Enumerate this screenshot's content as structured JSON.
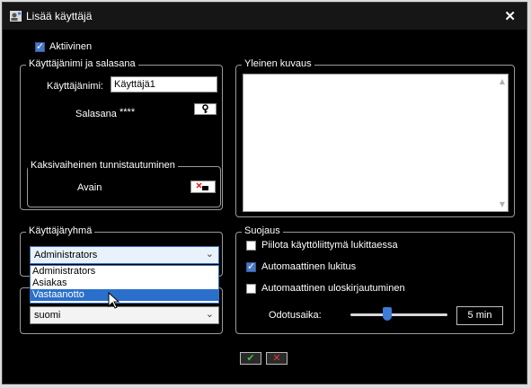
{
  "window": {
    "title": "Lisää käyttäjä"
  },
  "active": {
    "label": "Aktiivinen",
    "checked": true
  },
  "credentials": {
    "legend": "Käyttäjänimi ja salasana",
    "username_label": "Käyttäjänimi:",
    "username_value": "Käyttäjä1",
    "password_label": "Salasana",
    "password_value": "****"
  },
  "twofa": {
    "legend": "Kaksivaiheinen tunnistautuminen",
    "key_label": "Avain"
  },
  "description": {
    "legend": "Yleinen kuvaus",
    "value": ""
  },
  "usergroup": {
    "legend": "Käyttäjäryhmä",
    "selected": "Administrators",
    "options": [
      "Administrators",
      "Asiakas",
      "Vastaanotto"
    ],
    "highlighted": "Vastaanotto"
  },
  "language": {
    "selected": "suomi"
  },
  "security": {
    "legend": "Suojaus",
    "options": [
      {
        "label": "Piilota käyttöliittymä lukittaessa",
        "checked": false
      },
      {
        "label": "Automaattinen lukitus",
        "checked": true
      },
      {
        "label": "Automaattinen uloskirjautuminen",
        "checked": false
      }
    ],
    "timeout_label": "Odotusaika:",
    "timeout_value": "5 min"
  },
  "colors": {
    "accent": "#3f7bd8",
    "ok": "#3cc24a",
    "cancel": "#e23a3a"
  },
  "icons": [
    "user-settings-icon",
    "close-icon",
    "key-icon",
    "key-remove-icon",
    "chevron-down-icon",
    "check-icon",
    "cross-icon",
    "mouse-cursor-icon"
  ]
}
